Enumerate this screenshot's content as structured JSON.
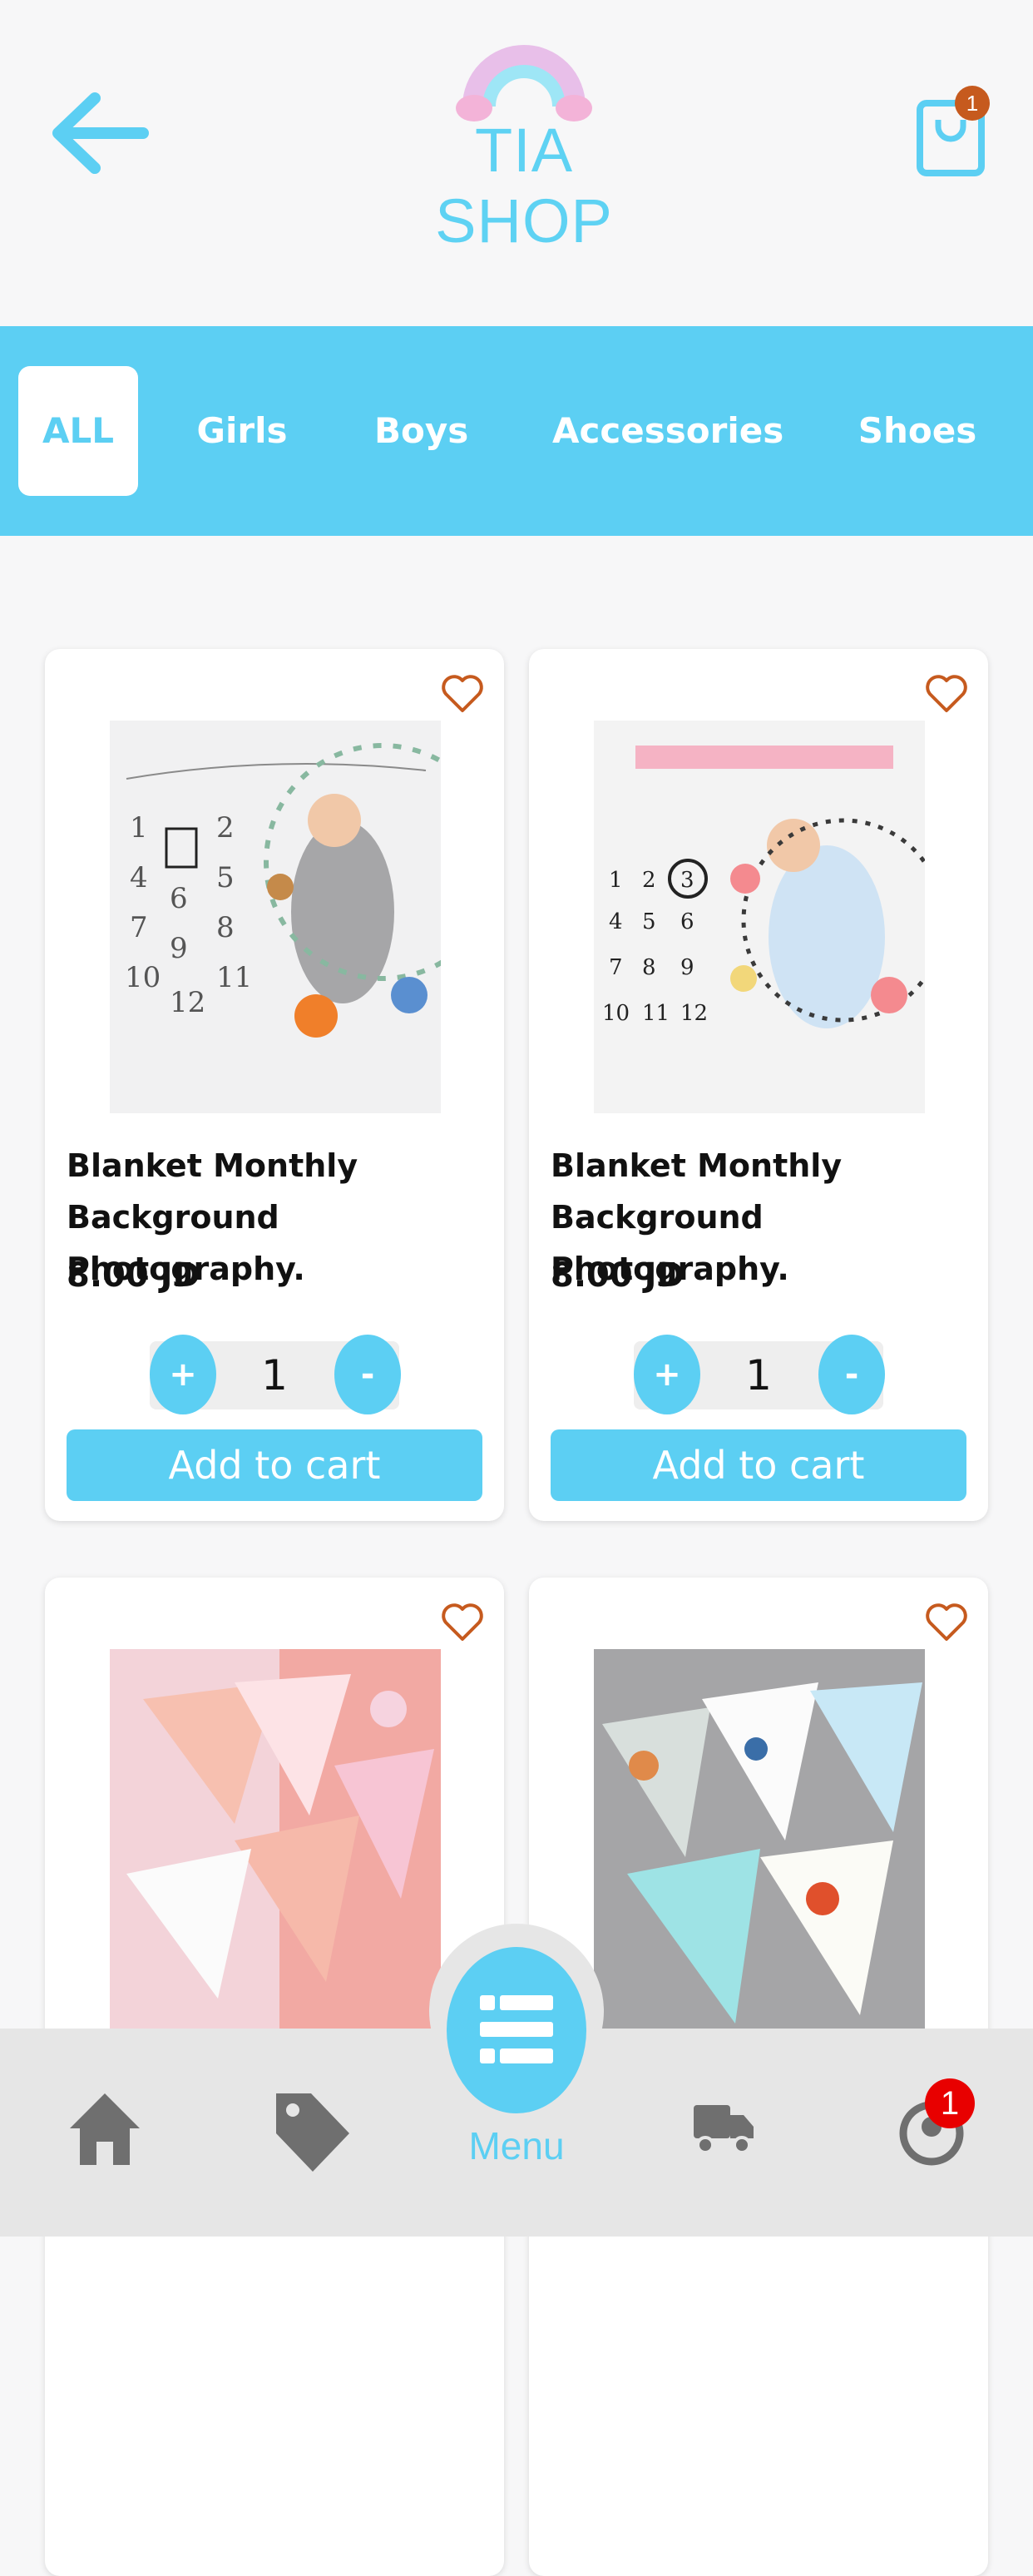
{
  "header": {
    "logo_text": "TIA SHOP",
    "cart_count": "1"
  },
  "categories": [
    "ALL",
    "Girls",
    "Boys",
    "Accessories",
    "Shoes"
  ],
  "products": [
    {
      "title": "Blanket Monthly Background Photography.",
      "price": "8.00 JD",
      "qty": "1",
      "add_label": "Add to cart",
      "plus": "+",
      "minus": "-"
    },
    {
      "title": "Blanket Monthly Background  Photography.",
      "price": "8.00 JD",
      "qty": "1",
      "add_label": "Add to cart",
      "plus": "+",
      "minus": "-"
    }
  ],
  "bottom_nav": {
    "menu_label": "Menu",
    "profile_badge": "1",
    "icons": [
      "home-icon",
      "tag-icon",
      "menu-icon",
      "truck-icon",
      "profile-icon"
    ]
  },
  "colors": {
    "accent": "#5ccff3",
    "badge_orange": "#c65a1e",
    "badge_red": "#e80000",
    "heart": "#c65a1e"
  }
}
